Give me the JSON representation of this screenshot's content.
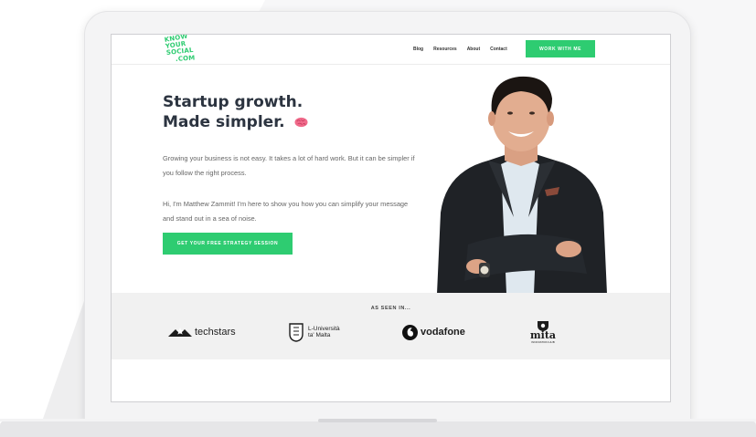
{
  "site": {
    "logo_lines": [
      "KNOW",
      "YOUR",
      "SOCIAL",
      ".COM"
    ]
  },
  "nav": {
    "items": [
      "Blog",
      "Resources",
      "About",
      "Contact"
    ],
    "cta": "WORK WITH ME"
  },
  "hero": {
    "title_line1": "Startup growth.",
    "title_line2": "Made simpler.",
    "paragraph1": "Growing your business is not easy. It takes a lot of hard work. But it can be simpler if you follow the right process.",
    "paragraph2": "Hi, I'm Matthew Zammit! I'm here to show you how you can simplify your message and stand out in a sea of noise.",
    "cta": "GET YOUR FREE STRATEGY SESSION"
  },
  "press": {
    "title": "AS SEEN IN...",
    "logos": {
      "techstars": "techstars",
      "malta_line1": "L-Università",
      "malta_line2": "ta' Malta",
      "vodafone": "vodafone",
      "mita": "mita",
      "mita_sub": "INNOVATION HUB"
    }
  },
  "colors": {
    "accent": "#2ecc71",
    "heading": "#2c3440",
    "body_text": "#666666",
    "band": "#f1f1f1"
  },
  "icons": [
    "brain-icon",
    "techstars-star-icon",
    "malta-crest-icon",
    "vodafone-speechmark-icon",
    "mita-shield-icon"
  ]
}
